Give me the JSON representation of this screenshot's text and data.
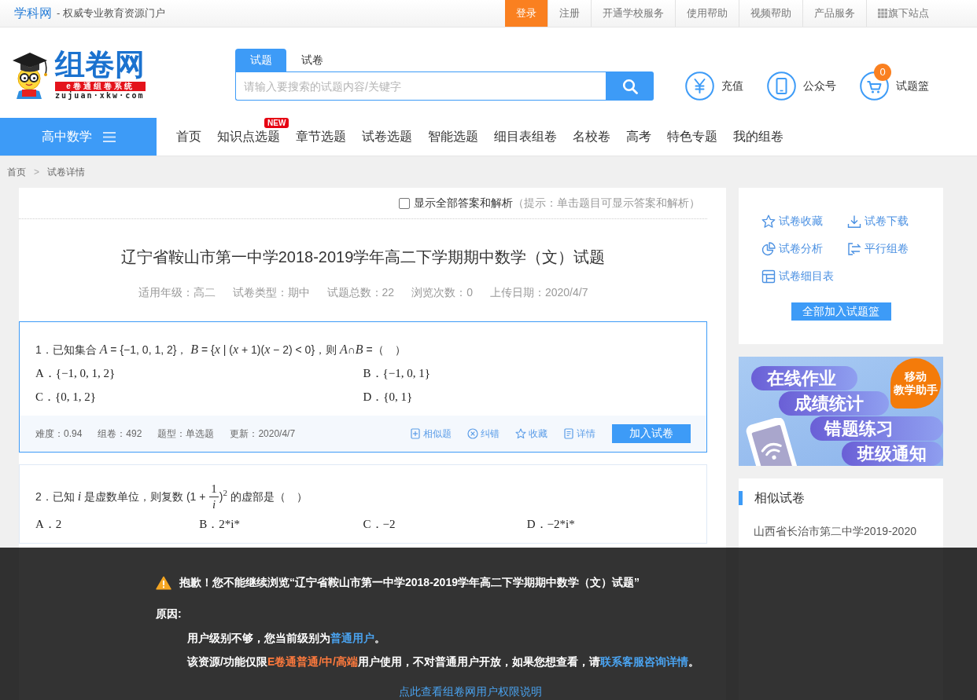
{
  "top_bar": {
    "brand": "学科网",
    "slogan": "- 权威专业教育资源门户",
    "links": [
      {
        "label": "登录",
        "kind": "primary"
      },
      {
        "label": "注册",
        "kind": "plain"
      },
      {
        "label": "开通学校服务",
        "kind": "plain"
      },
      {
        "label": "使用帮助",
        "kind": "plain"
      },
      {
        "label": "视频帮助",
        "kind": "plain"
      },
      {
        "label": "产品服务",
        "kind": "plain"
      },
      {
        "label": "旗下站点",
        "kind": "sites"
      }
    ]
  },
  "header": {
    "logo": {
      "title": "组卷网",
      "tagline": "e卷通组卷系统",
      "domain": "zujuan·xkw·com"
    },
    "search": {
      "tabs": [
        {
          "label": "试题",
          "selected": true
        },
        {
          "label": "试卷",
          "selected": false
        }
      ],
      "placeholder": "请输入要搜索的试题内容/关键字"
    },
    "shortcuts": [
      {
        "label": "充值",
        "kind": "yuan"
      },
      {
        "label": "公众号",
        "kind": "phone"
      },
      {
        "label": "试题篮",
        "kind": "cart",
        "count": "0"
      }
    ]
  },
  "nav": {
    "subject": "高中数学",
    "items": [
      {
        "label": "首页"
      },
      {
        "label": "知识点选题",
        "tag": "NEW"
      },
      {
        "label": "章节选题"
      },
      {
        "label": "试卷选题"
      },
      {
        "label": "智能选题"
      },
      {
        "label": "细目表组卷"
      },
      {
        "label": "名校卷"
      },
      {
        "label": "高考"
      },
      {
        "label": "特色专题"
      },
      {
        "label": "我的组卷"
      }
    ]
  },
  "breadcrumb": {
    "items": [
      "首页",
      "试卷详情"
    ],
    "separator": ">"
  },
  "paper": {
    "show_answers": {
      "label": "显示全部答案和解析",
      "checked": false,
      "hint": "（提示：单击题目可显示答案和解析）"
    },
    "title": "辽宁省鞍山市第一中学2018-2019学年高二下学期期中数学（文）试题",
    "meta": [
      "适用年级：高二",
      "试卷类型：期中",
      "试题总数：22",
      "浏览次数：0",
      "上传日期：2020/4/7"
    ],
    "questions": [
      {
        "selected": true,
        "stem": "1．已知集合 *A* = {−1, 0, 1, 2}，  *B* = {*x* | (*x* + 1)(*x* − 2) < 0}，则 *A*∩*B* =（　）",
        "options": [
          "A．{−1, 0, 1, 2}",
          "B．{−1, 0, 1}",
          "C．{0, 1, 2}",
          "D．{0, 1}"
        ],
        "stats": [
          "难度：0.94",
          "组卷：492",
          "题型：单选题",
          "更新：2020/4/7"
        ],
        "actions": [
          {
            "label": "相似题",
            "kind": "similar"
          },
          {
            "label": "纠错",
            "kind": "report"
          },
          {
            "label": "收藏",
            "kind": "favorite"
          },
          {
            "label": "详情",
            "kind": "detail"
          }
        ],
        "add_button": "加入试卷"
      },
      {
        "selected": false,
        "stem": [
          {
            "kind": "text",
            "text": "2．已知 *i* 是虚数单位，则复数 (1 + "
          },
          {
            "kind": "fraction",
            "numerator": "1",
            "denominator": "i"
          },
          {
            "kind": "text",
            "text": ")$^{2}$ 的虚部是（　）"
          }
        ],
        "options": [
          "A．2",
          "B．2*i*",
          "C．−2",
          "D．−2*i*"
        ]
      }
    ]
  },
  "paper_tools": {
    "actions": [
      {
        "label": "试卷收藏",
        "kind": "star"
      },
      {
        "label": "试卷下载",
        "kind": "download"
      },
      {
        "label": "试卷分析",
        "kind": "analysis"
      },
      {
        "label": "平行组卷",
        "kind": "parallel"
      },
      {
        "label": "试卷细目表",
        "kind": "table"
      }
    ],
    "button": "全部加入试题篮"
  },
  "banner": {
    "bubble": [
      "移动",
      "教学助手"
    ],
    "lines": [
      "在线作业",
      "成绩统计",
      "错题练习",
      "班级通知"
    ]
  },
  "similar": {
    "title": "相似试卷",
    "items": [
      "山西省长治市第二中学2019-2020"
    ]
  },
  "notice": {
    "title": "抱歉！您不能继续浏览“辽宁省鞍山市第一中学2018-2019学年高二下学期期中数学（文）试题”",
    "reason_label": "原因:",
    "reasons": [
      [
        {
          "kind": "text",
          "text": "用户级别不够，您当前级别为"
        },
        {
          "kind": "link",
          "text": "普通用户"
        },
        {
          "kind": "text",
          "text": "。"
        }
      ],
      [
        {
          "kind": "text",
          "text": "该资源/功能仅限"
        },
        {
          "kind": "highlight",
          "text": "E卷通普通/中/高端"
        },
        {
          "kind": "text",
          "text": "用户使用，不对普通用户开放，如果您想查看，请"
        },
        {
          "kind": "link",
          "text": "联系客服咨询详情"
        },
        {
          "kind": "text",
          "text": "。"
        }
      ]
    ],
    "link": "点此查看组卷网用户权限说明"
  }
}
